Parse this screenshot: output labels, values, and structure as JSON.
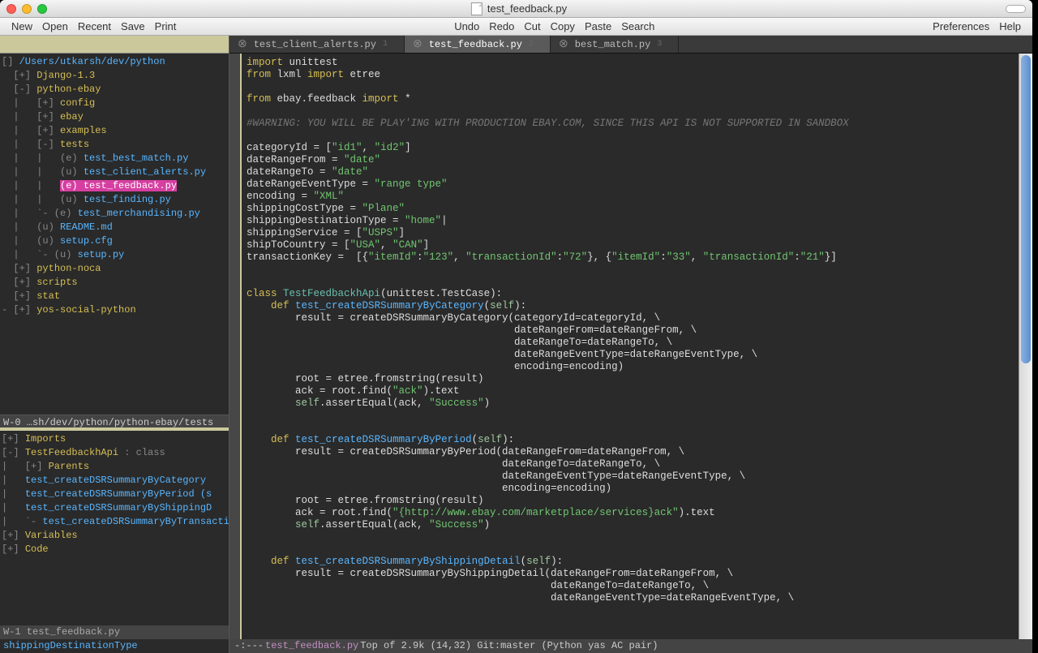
{
  "titlebar": {
    "title": "test_feedback.py"
  },
  "traffic": {
    "close": "#ff5f57",
    "min": "#febc2e",
    "max": "#28c840"
  },
  "menu": {
    "left": [
      "New",
      "Open",
      "Recent",
      "Save",
      "Print"
    ],
    "center": [
      "Undo",
      "Redo",
      "Cut",
      "Copy",
      "Paste",
      "Search"
    ],
    "right": [
      "Preferences",
      "Help"
    ]
  },
  "tree": {
    "root": "/Users/utkarsh/dev/python",
    "lines": [
      {
        "pre": "  [+] ",
        "txt": "Django-1.3",
        "cls": "y"
      },
      {
        "pre": "  [-] ",
        "txt": "python-ebay",
        "cls": "y"
      },
      {
        "pre": "  |   [+] ",
        "txt": "config",
        "cls": "y"
      },
      {
        "pre": "  |   [+] ",
        "txt": "ebay",
        "cls": "y"
      },
      {
        "pre": "  |   [+] ",
        "txt": "examples",
        "cls": "y"
      },
      {
        "pre": "  |   [-] ",
        "txt": "tests",
        "cls": "y"
      },
      {
        "pre": "  |   |   (e) ",
        "txt": "test_best_match.py",
        "cls": "b"
      },
      {
        "pre": "  |   |   (u) ",
        "txt": "test_client_alerts.py",
        "cls": "b"
      },
      {
        "pre": "  |   |   ",
        "sel": true,
        "mid": "(e) ",
        "txt": "test_feedback.py",
        "cls": "b"
      },
      {
        "pre": "  |   |   (u) ",
        "txt": "test_finding.py",
        "cls": "b"
      },
      {
        "pre": "  |   `- (e) ",
        "txt": "test_merchandising.py",
        "cls": "b"
      },
      {
        "pre": "  |   (u) ",
        "txt": "README.md",
        "cls": "b"
      },
      {
        "pre": "  |   (u) ",
        "txt": "setup.cfg",
        "cls": "b"
      },
      {
        "pre": "  |   `- (u) ",
        "txt": "setup.py",
        "cls": "b"
      },
      {
        "pre": "  [+] ",
        "txt": "python-noca",
        "cls": "y"
      },
      {
        "pre": "  [+] ",
        "txt": "scripts",
        "cls": "y"
      },
      {
        "pre": "  [+] ",
        "txt": "stat",
        "cls": "y"
      },
      {
        "pre": "- [+] ",
        "txt": "yos-social-python",
        "cls": "y"
      }
    ]
  },
  "divider0": "W-0 …sh/dev/python/python-ebay/tests",
  "outline": {
    "lines": [
      {
        "pre": "[+] ",
        "txt": "Imports",
        "cls": "y"
      },
      {
        "pre": "[-] ",
        "txt": "TestFeedbackhApi",
        "post": " : class",
        "cls": "y"
      },
      {
        "pre": "|   [+] ",
        "txt": "Parents",
        "cls": "y"
      },
      {
        "pre": "|   ",
        "txt": "test_createDSRSummaryByCategory",
        "cls": "b"
      },
      {
        "pre": "|   ",
        "txt": "test_createDSRSummaryByPeriod (s",
        "cls": "b"
      },
      {
        "pre": "|   ",
        "txt": "test_createDSRSummaryByShippingD",
        "cls": "b"
      },
      {
        "pre": "|   `- ",
        "txt": "test_createDSRSummaryByTransacti",
        "cls": "b"
      },
      {
        "pre": "[+] ",
        "txt": "Variables",
        "cls": "y"
      },
      {
        "pre": "[+] ",
        "txt": "Code",
        "cls": "y"
      }
    ]
  },
  "divider1": "W-1 test_feedback.py",
  "echo": "shippingDestinationType",
  "tabs": [
    {
      "label": "test_client_alerts.py",
      "n": "1",
      "active": false
    },
    {
      "label": "test_feedback.py",
      "n": "2",
      "active": true
    },
    {
      "label": "best_match.py",
      "n": "3",
      "active": false
    }
  ],
  "status": {
    "pre": "-:---  ",
    "fname": "test_feedback.py",
    "post": "   Top of 2.9k (14,32)   Git:master  (Python yas AC pair)"
  },
  "code": [
    [
      [
        "kw",
        "import"
      ],
      "",
      " unittest"
    ],
    [
      [
        "kw",
        "from"
      ],
      "",
      " lxml ",
      [
        "kw",
        "import"
      ],
      "",
      " etree"
    ],
    [],
    [
      [
        "kw",
        "from"
      ],
      "",
      " ebay.feedback ",
      [
        "kw",
        "import"
      ],
      "",
      " *"
    ],
    [],
    [
      [
        "cmt",
        "#WARNING: YOU WILL BE PLAY'ING WITH PRODUCTION EBAY.COM, SINCE THIS API IS NOT SUPPORTED IN SANDBOX"
      ]
    ],
    [],
    [
      "categoryId = [",
      [
        "str",
        "\"id1\""
      ],
      ", ",
      [
        "str",
        "\"id2\""
      ],
      "]"
    ],
    [
      "dateRangeFrom = ",
      [
        "str",
        "\"date\""
      ]
    ],
    [
      "dateRangeTo = ",
      [
        "str",
        "\"date\""
      ]
    ],
    [
      "dateRangeEventType = ",
      [
        "str",
        "\"range type\""
      ]
    ],
    [
      "encoding = ",
      [
        "str",
        "\"XML\""
      ]
    ],
    [
      "shippingCostType = ",
      [
        "str",
        "\"Plane\""
      ]
    ],
    [
      "shippingDestinationType = ",
      [
        "str",
        "\"home\""
      ],
      "|"
    ],
    [
      "shippingService = [",
      [
        "str",
        "\"USPS\""
      ],
      "]"
    ],
    [
      "shipToCountry = [",
      [
        "str",
        "\"USA\""
      ],
      ", ",
      [
        "str",
        "\"CAN\""
      ],
      "]"
    ],
    [
      "transactionKey =  [{",
      [
        "str",
        "\"itemId\""
      ],
      ":",
      [
        "str",
        "\"123\""
      ],
      ", ",
      [
        "str",
        "\"transactionId\""
      ],
      ":",
      [
        "str",
        "\"72\""
      ],
      "}, {",
      [
        "str",
        "\"itemId\""
      ],
      ":",
      [
        "str",
        "\"33\""
      ],
      ", ",
      [
        "str",
        "\"transactionId\""
      ],
      ":",
      [
        "str",
        "\"21\""
      ],
      "}]"
    ],
    [],
    [],
    [
      [
        "kw",
        "class"
      ],
      " ",
      [
        "type",
        "TestFeedbackhApi"
      ],
      "(unittest.TestCase):"
    ],
    [
      "    ",
      [
        "kw",
        "def"
      ],
      " ",
      [
        "def",
        "test_createDSRSummaryByCategory"
      ],
      "(",
      [
        "self",
        "self"
      ],
      "):"
    ],
    [
      "        result = createDSRSummaryByCategory(categoryId=categoryId, \\"
    ],
    [
      "                                            dateRangeFrom=dateRangeFrom, \\"
    ],
    [
      "                                            dateRangeTo=dateRangeTo, \\"
    ],
    [
      "                                            dateRangeEventType=dateRangeEventType, \\"
    ],
    [
      "                                            encoding=encoding)"
    ],
    [
      "        root = etree.fromstring(result)"
    ],
    [
      "        ack = root.find(",
      [
        "str",
        "\"ack\""
      ],
      ").text"
    ],
    [
      "        ",
      [
        "self",
        "self"
      ],
      ".assertEqual(ack, ",
      [
        "str",
        "\"Success\""
      ],
      ")"
    ],
    [],
    [],
    [
      "    ",
      [
        "kw",
        "def"
      ],
      " ",
      [
        "def",
        "test_createDSRSummaryByPeriod"
      ],
      "(",
      [
        "self",
        "self"
      ],
      "):"
    ],
    [
      "        result = createDSRSummaryByPeriod(dateRangeFrom=dateRangeFrom, \\"
    ],
    [
      "                                          dateRangeTo=dateRangeTo, \\"
    ],
    [
      "                                          dateRangeEventType=dateRangeEventType, \\"
    ],
    [
      "                                          encoding=encoding)"
    ],
    [
      "        root = etree.fromstring(result)"
    ],
    [
      "        ack = root.find(",
      [
        "str",
        "\"{http://www.ebay.com/marketplace/services}ack\""
      ],
      ").text"
    ],
    [
      "        ",
      [
        "self",
        "self"
      ],
      ".assertEqual(ack, ",
      [
        "str",
        "\"Success\""
      ],
      ")"
    ],
    [],
    [],
    [
      "    ",
      [
        "kw",
        "def"
      ],
      " ",
      [
        "def",
        "test_createDSRSummaryByShippingDetail"
      ],
      "(",
      [
        "self",
        "self"
      ],
      "):"
    ],
    [
      "        result = createDSRSummaryByShippingDetail(dateRangeFrom=dateRangeFrom, \\"
    ],
    [
      "                                                  dateRangeTo=dateRangeTo, \\"
    ],
    [
      "                                                  dateRangeEventType=dateRangeEventType, \\"
    ]
  ]
}
